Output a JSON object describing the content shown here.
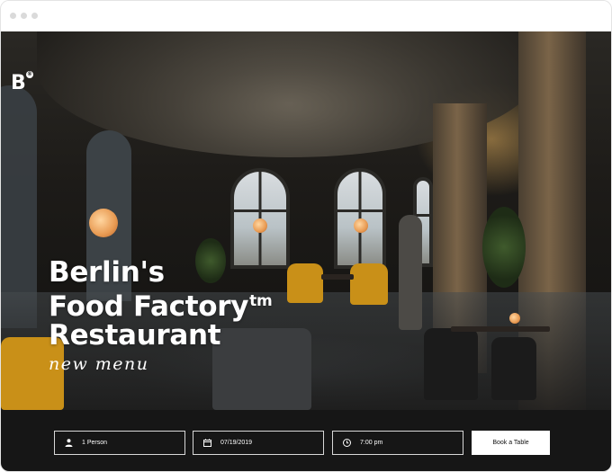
{
  "brand": {
    "logo": "B",
    "registered_mark": "®"
  },
  "hero": {
    "headline_line1": "Berlin's",
    "headline_line2": "Food Factory",
    "headline_mark": "tm",
    "headline_line3": "Restaurant",
    "tagline": "new menu"
  },
  "booking": {
    "persons": {
      "icon": "person-icon",
      "value": "1 Person"
    },
    "date": {
      "icon": "calendar-icon",
      "value": "07/19/2019"
    },
    "time": {
      "icon": "clock-icon",
      "value": "7:00 pm"
    },
    "book_button_label": "Book a Table"
  },
  "colors": {
    "booking_bar": "#161616",
    "button_bg": "#ffffff",
    "text": "#ffffff"
  }
}
